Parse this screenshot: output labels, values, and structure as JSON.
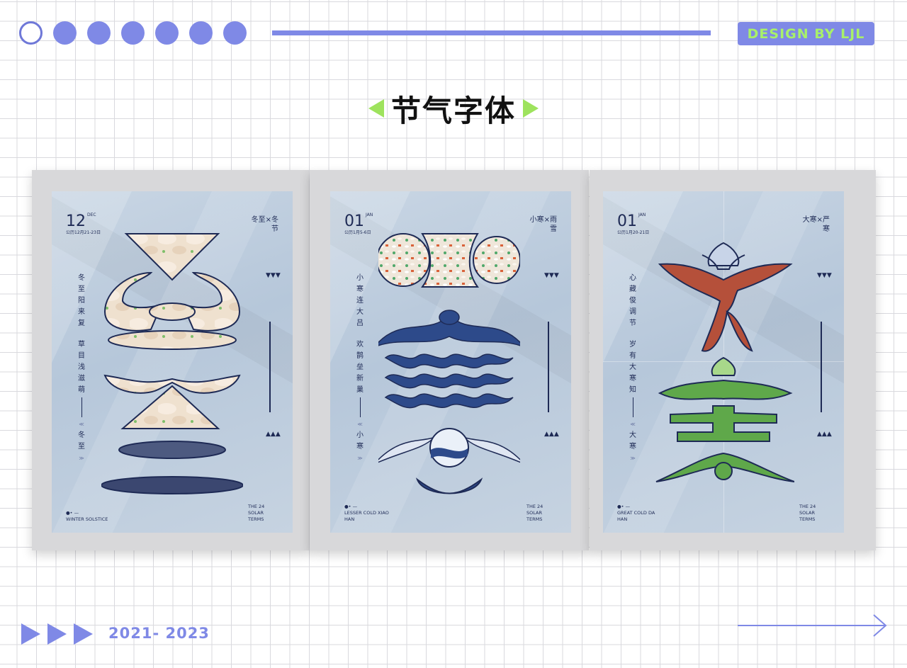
{
  "header": {
    "badge": "DESIGN BY LJL",
    "title": "节气字体",
    "accent": "#7f89e6",
    "green": "#9ee35d"
  },
  "posters": [
    {
      "number": "12",
      "month": "DEC",
      "date": "公历12月21-23日",
      "tag": "冬至×冬节",
      "verse1": [
        "冬",
        "至",
        "阳",
        "来",
        "复"
      ],
      "verse2": [
        "草",
        "目",
        "浅",
        "滋",
        "萌"
      ],
      "term": [
        "冬",
        "至"
      ],
      "arrows_top": "▼▼▼",
      "arrows_bottom": "▲▲▲",
      "foot_left": "WINTER SOLSTICE",
      "foot_right": "THE 24 SOLAR TERMS"
    },
    {
      "number": "01",
      "month": "JAN",
      "date": "公历1月5-6日",
      "tag": "小寒×雨雪",
      "verse1": [
        "小",
        "寒",
        "连",
        "大",
        "吕"
      ],
      "verse2": [
        "欢",
        "鹊",
        "垒",
        "新",
        "巢"
      ],
      "term": [
        "小",
        "寒"
      ],
      "arrows_top": "▼▼▼",
      "arrows_bottom": "▲▲▲",
      "foot_left": "LESSER COLD XIAO HAN",
      "foot_right": "THE 24 SOLAR TERMS"
    },
    {
      "number": "01",
      "month": "JAN",
      "date": "公历1月20-21日",
      "tag": "大寒×严寒",
      "verse1": [
        "心",
        "藏",
        "俊",
        "调",
        "节"
      ],
      "verse2": [
        "岁",
        "有",
        "大",
        "寒",
        "知"
      ],
      "term": [
        "大",
        "寒"
      ],
      "arrows_top": "▼▼▼",
      "arrows_bottom": "▲▲▲",
      "foot_left": "GREAT COLD DA HAN",
      "foot_right": "THE 24 SOLAR TERMS"
    }
  ],
  "footer": {
    "years": "2021- 2023"
  }
}
